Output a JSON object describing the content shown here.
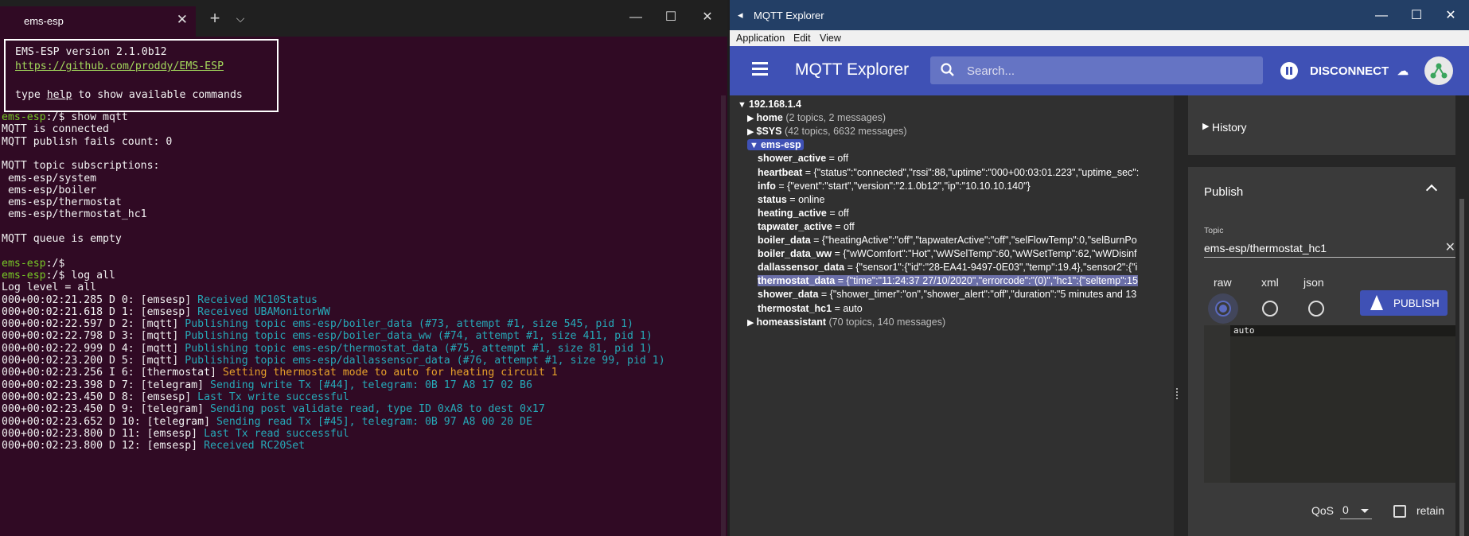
{
  "terminal": {
    "tab_title": "ems-esp",
    "close_glyph": "✕",
    "new_tab_glyph": "+",
    "dropdown_glyph": "⌵",
    "window_controls": {
      "minimize": "—",
      "maximize": "☐",
      "close": "✕"
    },
    "banner": [
      "EMS-ESP version 2.1.0b12",
      "https://github.com/proddy/EMS-ESP",
      "",
      "type help to show available commands"
    ],
    "banner_help_prefix": "type ",
    "banner_help_word": "help",
    "banner_help_suffix": " to show available commands",
    "prompt_host": "ems-esp",
    "prompt_tail": ":/$ ",
    "lines": [
      {
        "kind": "prompt",
        "cmd": "show mqtt"
      },
      {
        "kind": "text",
        "text": "MQTT is connected"
      },
      {
        "kind": "text",
        "text": "MQTT publish fails count: 0"
      },
      {
        "kind": "blank"
      },
      {
        "kind": "text",
        "text": "MQTT topic subscriptions:"
      },
      {
        "kind": "text",
        "text": " ems-esp/system"
      },
      {
        "kind": "text",
        "text": " ems-esp/boiler"
      },
      {
        "kind": "text",
        "text": " ems-esp/thermostat"
      },
      {
        "kind": "text",
        "text": " ems-esp/thermostat_hc1"
      },
      {
        "kind": "blank"
      },
      {
        "kind": "text",
        "text": "MQTT queue is empty"
      },
      {
        "kind": "blank"
      },
      {
        "kind": "prompt",
        "cmd": ""
      },
      {
        "kind": "prompt",
        "cmd": "log all"
      },
      {
        "kind": "text",
        "text": "Log level = all"
      },
      {
        "kind": "log",
        "prefix": "000+00:02:21.285 D 0: [emsesp] ",
        "msg": "Received MC10Status",
        "color": "cyan"
      },
      {
        "kind": "log",
        "prefix": "000+00:02:21.618 D 1: [emsesp] ",
        "msg": "Received UBAMonitorWW",
        "color": "cyan"
      },
      {
        "kind": "log",
        "prefix": "000+00:02:22.597 D 2: [mqtt] ",
        "msg": "Publishing topic ems-esp/boiler_data (#73, attempt #1, size 545, pid 1)",
        "color": "cyan"
      },
      {
        "kind": "log",
        "prefix": "000+00:02:22.798 D 3: [mqtt] ",
        "msg": "Publishing topic ems-esp/boiler_data_ww (#74, attempt #1, size 411, pid 1)",
        "color": "cyan"
      },
      {
        "kind": "log",
        "prefix": "000+00:02:22.999 D 4: [mqtt] ",
        "msg": "Publishing topic ems-esp/thermostat_data (#75, attempt #1, size 81, pid 1)",
        "color": "cyan"
      },
      {
        "kind": "log",
        "prefix": "000+00:02:23.200 D 5: [mqtt] ",
        "msg": "Publishing topic ems-esp/dallassensor_data (#76, attempt #1, size 99, pid 1)",
        "color": "cyan"
      },
      {
        "kind": "log",
        "prefix": "000+00:02:23.256 I 6: [thermostat] ",
        "msg": "Setting thermostat mode to auto for heating circuit 1",
        "color": "orange"
      },
      {
        "kind": "log",
        "prefix": "000+00:02:23.398 D 7: [telegram] ",
        "msg": "Sending write Tx [#44], telegram: 0B 17 A8 17 02 B6",
        "color": "cyan"
      },
      {
        "kind": "log",
        "prefix": "000+00:02:23.450 D 8: [emsesp] ",
        "msg": "Last Tx write successful",
        "color": "cyan"
      },
      {
        "kind": "log",
        "prefix": "000+00:02:23.450 D 9: [telegram] ",
        "msg": "Sending post validate read, type ID 0xA8 to dest 0x17",
        "color": "cyan"
      },
      {
        "kind": "log",
        "prefix": "000+00:02:23.652 D 10: [telegram] ",
        "msg": "Sending read Tx [#45], telegram: 0B 97 A8 00 20 DE",
        "color": "cyan"
      },
      {
        "kind": "log",
        "prefix": "000+00:02:23.800 D 11: [emsesp] ",
        "msg": "Last Tx read successful",
        "color": "cyan"
      },
      {
        "kind": "log",
        "prefix": "000+00:02:23.800 D 12: [emsesp] ",
        "msg": "Received RC20Set",
        "color": "cyan"
      }
    ]
  },
  "mqtt": {
    "window_title": "MQTT Explorer",
    "window_icon": "◂",
    "window_controls": {
      "minimize": "—",
      "maximize": "☐",
      "close": "✕"
    },
    "menu": [
      "Application",
      "Edit",
      "View"
    ],
    "app_title": "MQTT Explorer",
    "search_placeholder": "Search...",
    "disconnect_label": "DISCONNECT",
    "cloud_glyph": "☁",
    "tree": [
      {
        "depth": 0,
        "arrow": "▼",
        "name": "192.168.1.4",
        "meta": "",
        "value": ""
      },
      {
        "depth": 1,
        "arrow": "▶",
        "name": "home",
        "meta": " (2 topics, 2 messages)",
        "value": ""
      },
      {
        "depth": 1,
        "arrow": "▶",
        "name": "$SYS",
        "meta": " (42 topics, 6632 messages)",
        "value": ""
      },
      {
        "depth": 1,
        "arrow": "▼",
        "name": "ems-esp",
        "meta": "",
        "value": "",
        "selected": true
      },
      {
        "depth": 2,
        "arrow": "",
        "name": "shower_active",
        "meta": "",
        "value": " = off"
      },
      {
        "depth": 2,
        "arrow": "",
        "name": "heartbeat",
        "meta": "",
        "value": " = {\"status\":\"connected\",\"rssi\":88,\"uptime\":\"000+00:03:01.223\",\"uptime_sec\":"
      },
      {
        "depth": 2,
        "arrow": "",
        "name": "info",
        "meta": "",
        "value": " = {\"event\":\"start\",\"version\":\"2.1.0b12\",\"ip\":\"10.10.10.140\"}"
      },
      {
        "depth": 2,
        "arrow": "",
        "name": "status",
        "meta": "",
        "value": " = online"
      },
      {
        "depth": 2,
        "arrow": "",
        "name": "heating_active",
        "meta": "",
        "value": " = off"
      },
      {
        "depth": 2,
        "arrow": "",
        "name": "tapwater_active",
        "meta": "",
        "value": " = off"
      },
      {
        "depth": 2,
        "arrow": "",
        "name": "boiler_data",
        "meta": "",
        "value": " = {\"heatingActive\":\"off\",\"tapwaterActive\":\"off\",\"selFlowTemp\":0,\"selBurnPo"
      },
      {
        "depth": 2,
        "arrow": "",
        "name": "boiler_data_ww",
        "meta": "",
        "value": " = {\"wWComfort\":\"Hot\",\"wWSelTemp\":60,\"wWSetTemp\":62,\"wWDisinf"
      },
      {
        "depth": 2,
        "arrow": "",
        "name": "dallassensor_data",
        "meta": "",
        "value": " = {\"sensor1\":{\"id\":\"28-EA41-9497-0E03\",\"temp\":19.4},\"sensor2\":{\"i"
      },
      {
        "depth": 2,
        "arrow": "",
        "name": "thermostat_data",
        "meta": "",
        "value": " = {\"time\":\"11:24:37 27/10/2020\",\"errorcode\":\"(0)\",\"hc1\":{\"seltemp\":15",
        "highlight": true
      },
      {
        "depth": 2,
        "arrow": "",
        "name": "shower_data",
        "meta": "",
        "value": " = {\"shower_timer\":\"on\",\"shower_alert\":\"off\",\"duration\":\"5 minutes and 13"
      },
      {
        "depth": 2,
        "arrow": "",
        "name": "thermostat_hc1",
        "meta": "",
        "value": " = auto"
      },
      {
        "depth": 1,
        "arrow": "▶",
        "name": "homeassistant",
        "meta": " (70 topics, 140 messages)",
        "value": ""
      }
    ],
    "history_label": "History",
    "history_arrow": "▶",
    "publish": {
      "title": "Publish",
      "topic_label": "Topic",
      "topic_value": "ems-esp/thermostat_hc1",
      "clear_glyph": "✕",
      "formats": [
        "raw",
        "xml",
        "json"
      ],
      "selected_format": "raw",
      "button_label": "PUBLISH",
      "payload": "auto",
      "qos_label": "QoS",
      "qos_value": "0",
      "retain_label": "retain"
    }
  }
}
